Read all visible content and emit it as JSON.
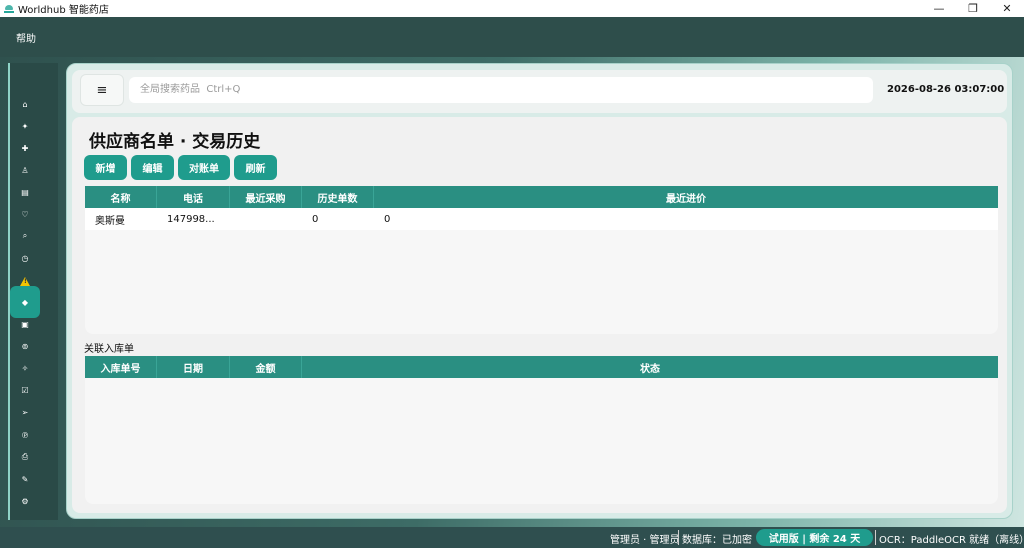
{
  "window": {
    "title": "Worldhub 智能药店",
    "minimize": "—",
    "maximize": "❐",
    "close": "✕"
  },
  "menubar": {
    "help": "帮助"
  },
  "topbar": {
    "menu_icon": "≡",
    "search_placeholder": "全局搜索药品  Ctrl+Q",
    "datetime": "2026-08-26  03:07:00"
  },
  "sidebar": {
    "items": [
      {
        "icon": "home-icon",
        "glyph": "⌂"
      },
      {
        "icon": "sparkle-icon",
        "glyph": "✦"
      },
      {
        "icon": "plus-icon",
        "glyph": "✚"
      },
      {
        "icon": "person-icon",
        "glyph": "♙"
      },
      {
        "icon": "document-icon",
        "glyph": "▤"
      },
      {
        "icon": "heart-icon",
        "glyph": "♡"
      },
      {
        "icon": "search-icon",
        "glyph": "⌕"
      },
      {
        "icon": "clock-icon",
        "glyph": "◷"
      },
      {
        "icon": "warning-icon",
        "glyph": "!"
      },
      {
        "icon": "supplier-icon",
        "glyph": "◆"
      },
      {
        "icon": "grid-icon",
        "glyph": "▣"
      },
      {
        "icon": "ring-icon",
        "glyph": "⊚"
      },
      {
        "icon": "star-icon",
        "glyph": "✧"
      },
      {
        "icon": "edit-icon",
        "glyph": "☑"
      },
      {
        "icon": "send-icon",
        "glyph": "➢"
      },
      {
        "icon": "copyright-icon",
        "glyph": "℗"
      },
      {
        "icon": "printer-icon",
        "glyph": "⎙"
      },
      {
        "icon": "pen-icon",
        "glyph": "✎"
      },
      {
        "icon": "settings-icon",
        "glyph": "⚙"
      }
    ]
  },
  "page": {
    "title": "供应商名单 · 交易历史",
    "buttons": {
      "add": "新增",
      "edit": "编辑",
      "reconcile": "对账单",
      "refresh": "刷新"
    }
  },
  "supplier_table": {
    "columns": [
      "名称",
      "电话",
      "最近采购",
      "历史单数",
      "最近进价"
    ],
    "rows": [
      [
        "奥斯曼",
        "147998...",
        "",
        "0",
        "0"
      ]
    ]
  },
  "inbound_section": {
    "label": "关联入库单",
    "columns": [
      "入库单号",
      "日期",
      "金额",
      "状态"
    ]
  },
  "statusbar": {
    "user": "管理员 · 管理员",
    "database": "数据库：已加密",
    "trial": "试用版 | 剩余 24 天",
    "ocr": "OCR：PaddleOCR 就绪（离线）"
  },
  "colors": {
    "accent": "#1f9c8d",
    "header": "#2a8f82",
    "chrome": "#2f4f4f"
  }
}
